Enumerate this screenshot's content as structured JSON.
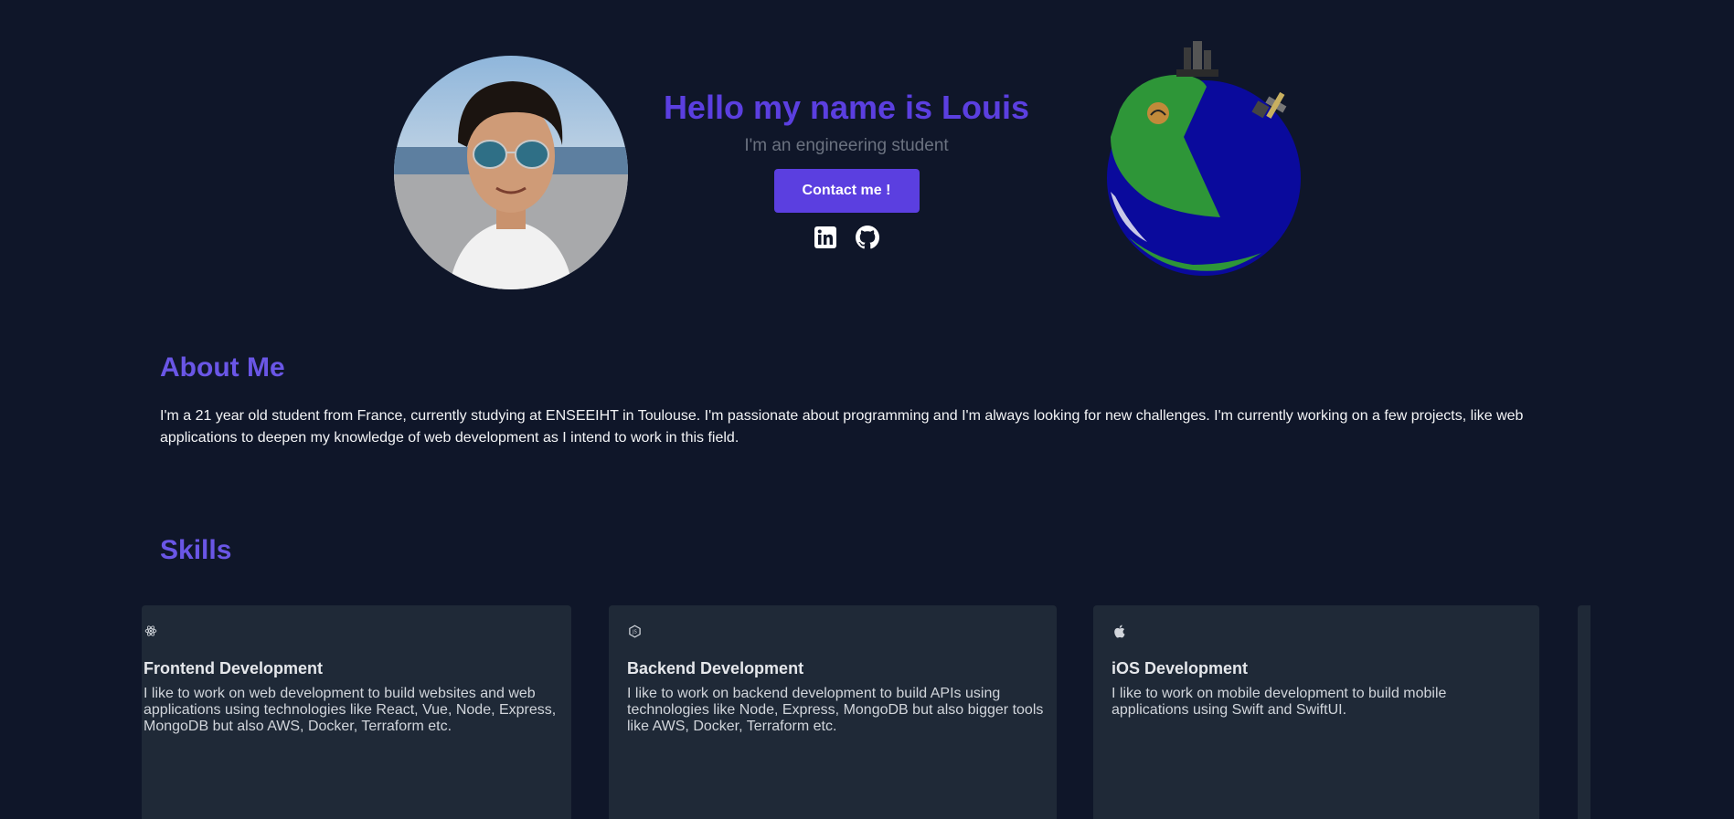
{
  "hero": {
    "title": "Hello my name is Louis",
    "subtitle": "I'm an engineering student",
    "contact_button": "Contact me !",
    "socials": [
      {
        "icon": "linkedin-icon"
      },
      {
        "icon": "github-icon"
      }
    ]
  },
  "about": {
    "title": "About Me",
    "text": "I'm a 21 year old student from France, currently studying at ENSEEIHT in Toulouse. I'm passionate about programming and I'm always looking for new challenges. I'm currently working on a few projects, like web applications to deepen my knowledge of web development as I intend to work in this field."
  },
  "skills": {
    "title": "Skills",
    "cards": [
      {
        "icon": "react-icon",
        "title": "Frontend Development",
        "description": "I like to work on web development to build websites and web applications using technologies like React, Vue, Node, Express, MongoDB but also AWS, Docker, Terraform etc."
      },
      {
        "icon": "nodejs-icon",
        "title": "Backend Development",
        "description": "I like to work on backend development to build APIs using technologies like Node, Express, MongoDB but also bigger tools like AWS, Docker, Terraform etc."
      },
      {
        "icon": "apple-icon",
        "title": "iOS Development",
        "description": "I like to work on mobile development to build mobile applications using Swift and SwiftUI."
      }
    ]
  },
  "colors": {
    "background": "#0f1629",
    "accent": "#5b3fe0",
    "card": "#1f2937"
  }
}
